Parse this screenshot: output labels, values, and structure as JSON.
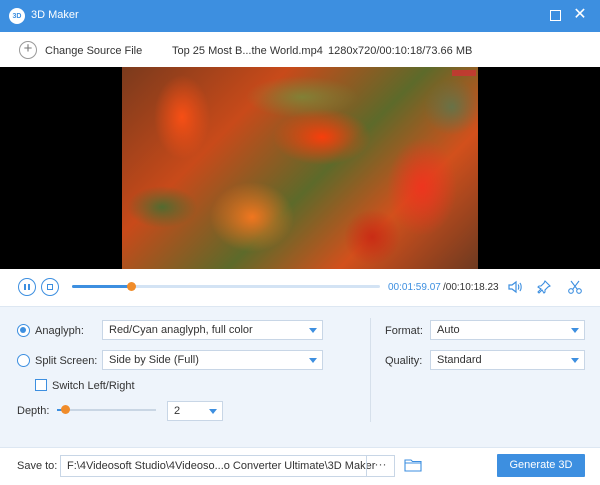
{
  "window": {
    "app_logo": "3D",
    "title": "3D Maker"
  },
  "source": {
    "change_label": "Change Source File",
    "file_name": "Top 25 Most B...the World.mp4",
    "file_meta": "1280x720/00:10:18/73.66 MB"
  },
  "playback": {
    "current_time": "00:01:59.07",
    "total_time": "/00:10:18.23",
    "progress_fraction": 0.193
  },
  "settings": {
    "anaglyph_label": "Anaglyph:",
    "anaglyph_value": "Red/Cyan anaglyph, full color",
    "split_label": "Split Screen:",
    "split_value": "Side by Side (Full)",
    "switch_label": "Switch Left/Right",
    "depth_label": "Depth:",
    "depth_value": "2",
    "depth_fraction": 0.08,
    "format_label": "Format:",
    "format_value": "Auto",
    "quality_label": "Quality:",
    "quality_value": "Standard"
  },
  "save": {
    "label": "Save to:",
    "path": "F:\\4Videosoft Studio\\4Videoso...o Converter Ultimate\\3D Maker",
    "browse_label": "···",
    "generate_label": "Generate 3D"
  },
  "colors": {
    "accent": "#3d8fe0",
    "thumb": "#f08c2a"
  }
}
